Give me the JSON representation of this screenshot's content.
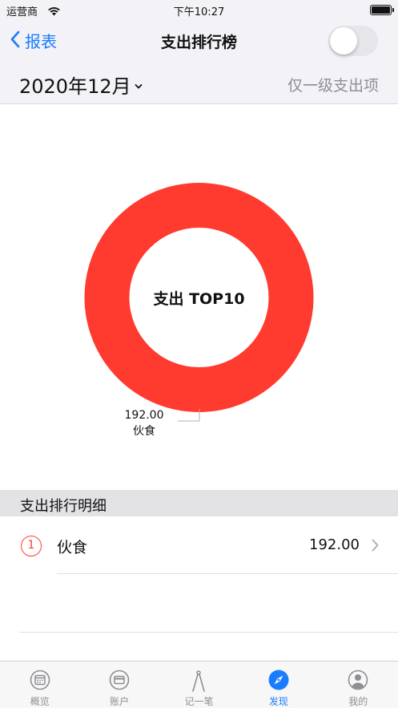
{
  "status_bar": {
    "carrier": "运营商",
    "time": "下午10:27"
  },
  "nav": {
    "back_label": "报表",
    "title": "支出排行榜",
    "toggle_on": false
  },
  "filter": {
    "month": "2020年12月",
    "first_level_only": "仅一级支出项"
  },
  "chart_data": {
    "type": "pie",
    "center_label": "支出 TOP10",
    "slices": [
      {
        "label": "伙食",
        "value": 192.0,
        "value_text": "192.00",
        "color": "#ff3b30"
      }
    ]
  },
  "section": {
    "title": "支出排行明细"
  },
  "ranking": [
    {
      "rank": "1",
      "name": "伙食",
      "amount": "192.00"
    }
  ],
  "tabs": [
    {
      "label": "概览",
      "icon": "calendar-icon",
      "active": false
    },
    {
      "label": "账户",
      "icon": "card-icon",
      "active": false
    },
    {
      "label": "记一笔",
      "icon": "compass-pen-icon",
      "active": false
    },
    {
      "label": "发现",
      "icon": "compass-icon",
      "active": true
    },
    {
      "label": "我的",
      "icon": "person-icon",
      "active": false
    }
  ],
  "colors": {
    "accent": "#1a7cff",
    "expense": "#ff3b30",
    "muted": "#8e8e93"
  }
}
